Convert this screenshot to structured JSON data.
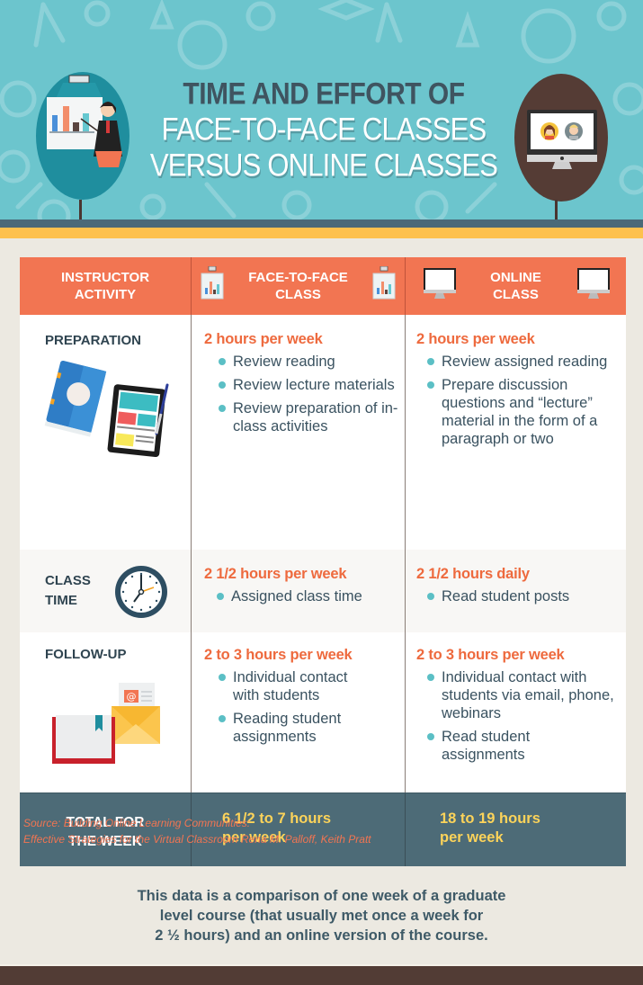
{
  "header": {
    "title_line1": "TIME AND EFFORT OF",
    "title_line2": "FACE-TO-FACE CLASSES",
    "title_line3": "VERSUS ONLINE CLASSES",
    "left_illustration": "teacher-presenting-chart-icon",
    "right_illustration": "computer-with-video-call-icon"
  },
  "colors": {
    "hero_bg": "#6CC5CD",
    "accent_orange": "#F27552",
    "band_dark": "#4A6978",
    "band_yellow": "#FDC14E",
    "total_bg": "#4D6B77",
    "total_text": "#FCD35A",
    "bullet": "#5BBFC5",
    "footer": "#523C35"
  },
  "table": {
    "headers": [
      {
        "label_line1": "INSTRUCTOR",
        "label_line2": "ACTIVITY"
      },
      {
        "label_line1": "FACE-TO-FACE",
        "label_line2": "CLASS",
        "icon": "whiteboard-chart-icon"
      },
      {
        "label_line1": "ONLINE",
        "label_line2": "CLASS",
        "icon": "desktop-monitor-icon"
      }
    ],
    "rows": [
      {
        "activity": "PREPARATION",
        "icon": "book-and-tablet-icon",
        "face_to_face": {
          "hours": "2 hours per week",
          "items": [
            "Review reading",
            "Review lecture materials",
            "Review preparation of in-class activities"
          ]
        },
        "online": {
          "hours": "2 hours per week",
          "items": [
            "Review assigned reading",
            "Prepare discussion questions and “lecture” material in the form of a paragraph or two"
          ]
        }
      },
      {
        "activity_line1": "CLASS",
        "activity_line2": "TIME",
        "icon": "clock-icon",
        "face_to_face": {
          "hours": "2 1/2 hours per week",
          "items": [
            "Assigned class time"
          ]
        },
        "online": {
          "hours": "2 1/2 hours daily",
          "items": [
            "Read student posts"
          ]
        }
      },
      {
        "activity": "FOLLOW-UP",
        "icon": "book-and-envelope-icon",
        "face_to_face": {
          "hours": "2 to 3 hours per week",
          "items": [
            "Individual contact with students",
            "Reading student assignments"
          ]
        },
        "online": {
          "hours": "2 to 3 hours per week",
          "items": [
            "Individual contact with students via email, phone, webinars",
            "Read student assignments"
          ]
        }
      }
    ],
    "total": {
      "label_line1": "TOTAL FOR",
      "label_line2": "THE WEEK",
      "face_to_face_line1": "6 1/2 to 7 hours",
      "face_to_face_line2": "per week",
      "online_line1": "18 to 19 hours",
      "online_line2": "per week"
    }
  },
  "source": {
    "line1": "Source: Building Online Learning Communities:",
    "line2": "Effective Strategies for the Virtual Classroom Rena M. Palloff, Keith Pratt"
  },
  "note": {
    "line1": "This data is a comparison of one week of a graduate",
    "line2": "level course (that usually met once a week for",
    "line3": "2 ½ hours) and an online version of the course."
  }
}
